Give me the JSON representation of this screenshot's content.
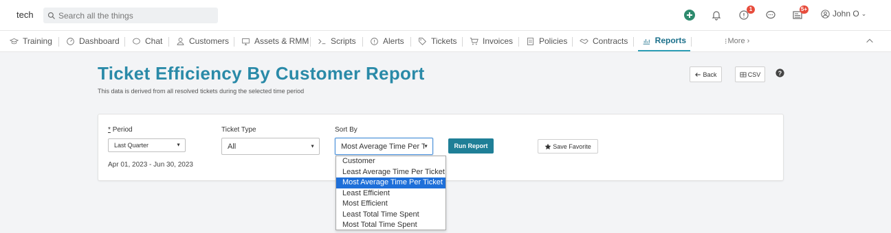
{
  "topbar": {
    "brand": "tech",
    "search_placeholder": "Search all the things",
    "alerts_badge": "1",
    "news_badge": "5+",
    "user_name": "John O"
  },
  "nav": {
    "items": [
      {
        "label": "Training",
        "icon": "graduation-cap-icon"
      },
      {
        "label": "Dashboard",
        "icon": "dashboard-icon"
      },
      {
        "label": "Chat",
        "icon": "chat-icon"
      },
      {
        "label": "Customers",
        "icon": "user-icon"
      },
      {
        "label": "Assets & RMM",
        "icon": "monitor-icon"
      },
      {
        "label": "Scripts",
        "icon": "terminal-icon"
      },
      {
        "label": "Alerts",
        "icon": "alert-icon"
      },
      {
        "label": "Tickets",
        "icon": "tag-icon"
      },
      {
        "label": "Invoices",
        "icon": "cart-icon"
      },
      {
        "label": "Policies",
        "icon": "document-icon"
      },
      {
        "label": "Contracts",
        "icon": "handshake-icon"
      },
      {
        "label": "Reports",
        "icon": "chart-icon"
      }
    ],
    "more_label": "More"
  },
  "page": {
    "title": "Ticket Efficiency By Customer Report",
    "subtitle": "This data is derived from all resolved tickets during the selected time period",
    "back_label": "Back",
    "csv_label": "CSV"
  },
  "filters": {
    "period_label": "Period",
    "period_required_mark": "*",
    "period_value": "Last Quarter",
    "period_range": "Apr 01, 2023 - Jun 30, 2023",
    "ticket_type_label": "Ticket Type",
    "ticket_type_value": "All",
    "sort_by_label": "Sort By",
    "sort_by_value": "Most Average Time Per T",
    "run_report_label": "Run Report",
    "save_favorite_label": "Save Favorite",
    "sort_options": [
      "Customer",
      "Least Average Time Per Ticket",
      "Most Average Time Per Ticket",
      "Least Efficient",
      "Most Efficient",
      "Least Total Time Spent",
      "Most Total Time Spent"
    ],
    "sort_selected_index": 2
  },
  "colors": {
    "accent": "#2a8aa8",
    "run_button": "#1f7f97",
    "highlight": "#1e6fd9",
    "badge": "#e74c3c"
  }
}
